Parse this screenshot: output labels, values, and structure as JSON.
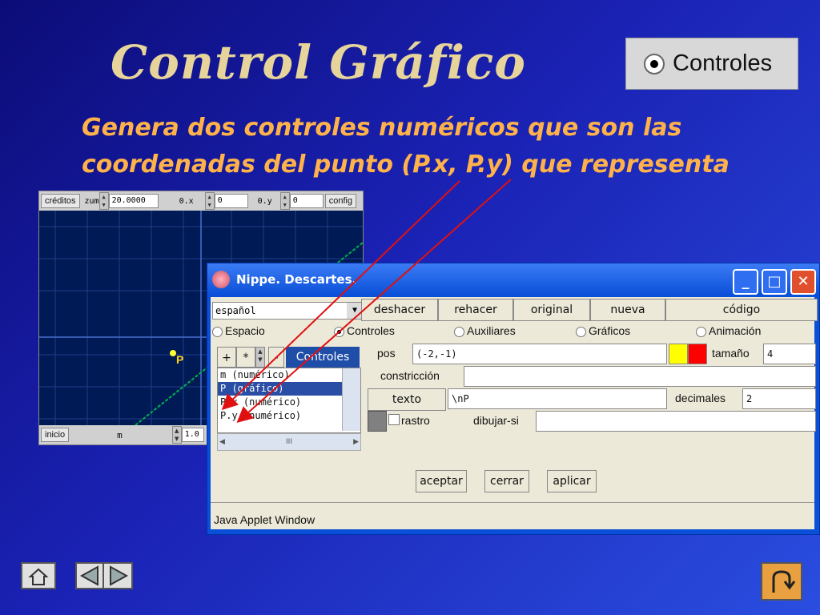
{
  "slide": {
    "title": "Control Gráfico",
    "subtitle": "Genera dos controles numéricos que son las coordenadas del punto (P.x, P.y) que representa",
    "badge_label": "Controles"
  },
  "applet": {
    "credits_btn": "créditos",
    "zoom_label": "zum",
    "zoom_value": "20.0000",
    "ox_label": "0.x",
    "ox_value": "0",
    "oy_label": "0.y",
    "oy_value": "0",
    "config_btn": "config",
    "point_label": "P",
    "start_btn": "inicio",
    "m_label": "m",
    "m_value": "1.0"
  },
  "window": {
    "title": "Nippe. Descartes.",
    "language": "español",
    "toolbar": [
      "deshacer",
      "rehacer",
      "original",
      "nueva",
      "código"
    ],
    "tabs": [
      "Espacio",
      "Controles",
      "Auxiliares",
      "Gráficos",
      "Animación"
    ],
    "selected_tab": "Controles",
    "add_btn": "+",
    "star_btn": "*",
    "minus_btn": "-",
    "list_header": "Controles",
    "list_items": [
      "m (numérico)",
      "P (gráfico)",
      "P.x (numérico)",
      "P.y (numérico)"
    ],
    "selected_item": "P (gráfico)",
    "scroll_thumb": "III",
    "pos_label": "pos",
    "pos_value": "(-2,-1)",
    "size_label": "tamaño",
    "size_value": "4",
    "constraint_label": "constricción",
    "constraint_value": "",
    "text_btn": "texto",
    "text_value": "\\nP",
    "decimals_label": "decimales",
    "decimals_value": "2",
    "trace_label": "rastro",
    "draw_if_label": "dibujar-si",
    "draw_if_value": "",
    "accept_btn": "aceptar",
    "close_btn": "cerrar",
    "apply_btn": "aplicar",
    "status": "Java Applet Window",
    "colors": {
      "yellow": "#ffff00",
      "red": "#ff0000",
      "gray": "#808080"
    }
  }
}
